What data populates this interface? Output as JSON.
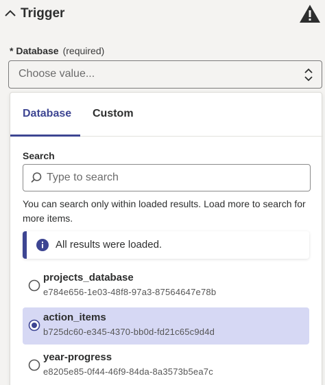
{
  "header": {
    "title": "Trigger",
    "collapse_icon": "chevron-up-icon",
    "warning_icon": "warning-triangle-icon"
  },
  "field": {
    "label": "* Database",
    "required_text": "(required)",
    "placeholder": "Choose value...",
    "icon": "updown-chevron-icon"
  },
  "dropdown": {
    "tabs": [
      {
        "label": "Database",
        "active": true
      },
      {
        "label": "Custom",
        "active": false
      }
    ],
    "search": {
      "label": "Search",
      "placeholder": "Type to search",
      "help": "You can search only within loaded results. Load more to search for more items."
    },
    "notice": "All results were loaded.",
    "options": [
      {
        "name": "projects_database",
        "id": "e784e656-1e03-48f8-97a3-87564647e78b",
        "selected": false
      },
      {
        "name": "action_items",
        "id": "b725dc60-e345-4370-bb0d-fd21c65c9d4d",
        "selected": true
      },
      {
        "name": "year-progress",
        "id": "e8205e85-0f44-46f9-84da-8a3573b5ea7c",
        "selected": false
      }
    ]
  },
  "colors": {
    "accent": "#3d4592",
    "selected_bg": "#d6d8f4",
    "page_bg": "#f4f3f1"
  }
}
